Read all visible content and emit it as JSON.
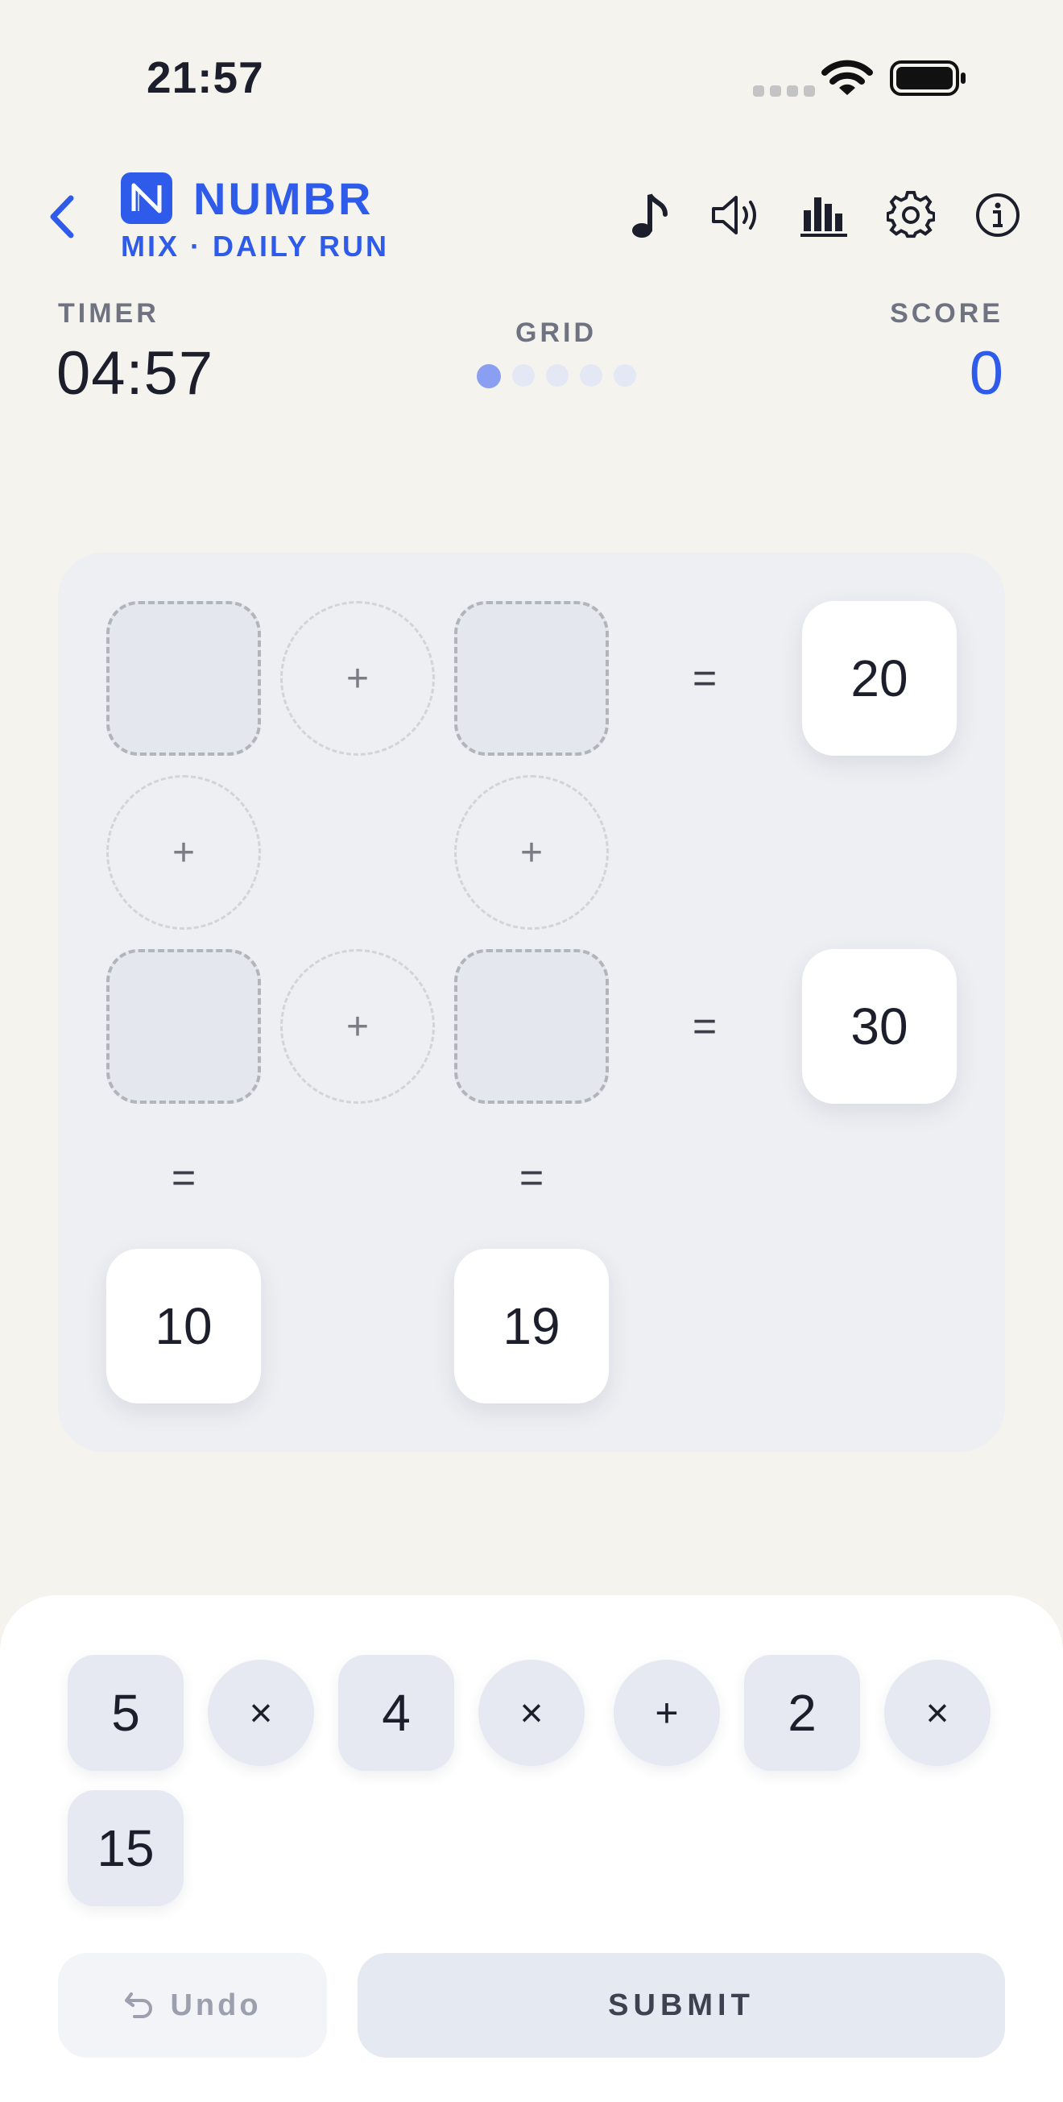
{
  "status_bar": {
    "time": "21:57"
  },
  "header": {
    "app_name": "NUMBR",
    "subtitle": "MIX · DAILY RUN",
    "logo_letter": "N",
    "icons": [
      "back-chevron-icon",
      "music-note-icon",
      "speaker-icon",
      "stats-bars-icon",
      "gear-icon",
      "info-icon"
    ]
  },
  "stats": {
    "timer_label": "TIMER",
    "timer_value": "04:57",
    "grid_label": "GRID",
    "grid_progress": {
      "current": 1,
      "total": 5
    },
    "score_label": "SCORE",
    "score_value": "0"
  },
  "board": {
    "row1": {
      "op": "+",
      "eq": "=",
      "target": "20"
    },
    "col_ops": [
      "+",
      "+"
    ],
    "row2": {
      "op": "+",
      "eq": "=",
      "target": "30"
    },
    "col_eqs": [
      "=",
      "="
    ],
    "col_targets": [
      "10",
      "19"
    ]
  },
  "tray": {
    "tiles": [
      "5",
      "×",
      "4",
      "×",
      "+",
      "2",
      "×",
      "15"
    ],
    "undo_label": "Undo",
    "submit_label": "SUBMIT"
  },
  "colors": {
    "accent": "#2e5bea",
    "background": "#f5f3ee",
    "board": "#eeeff3",
    "tile": "#e6e9f2"
  }
}
